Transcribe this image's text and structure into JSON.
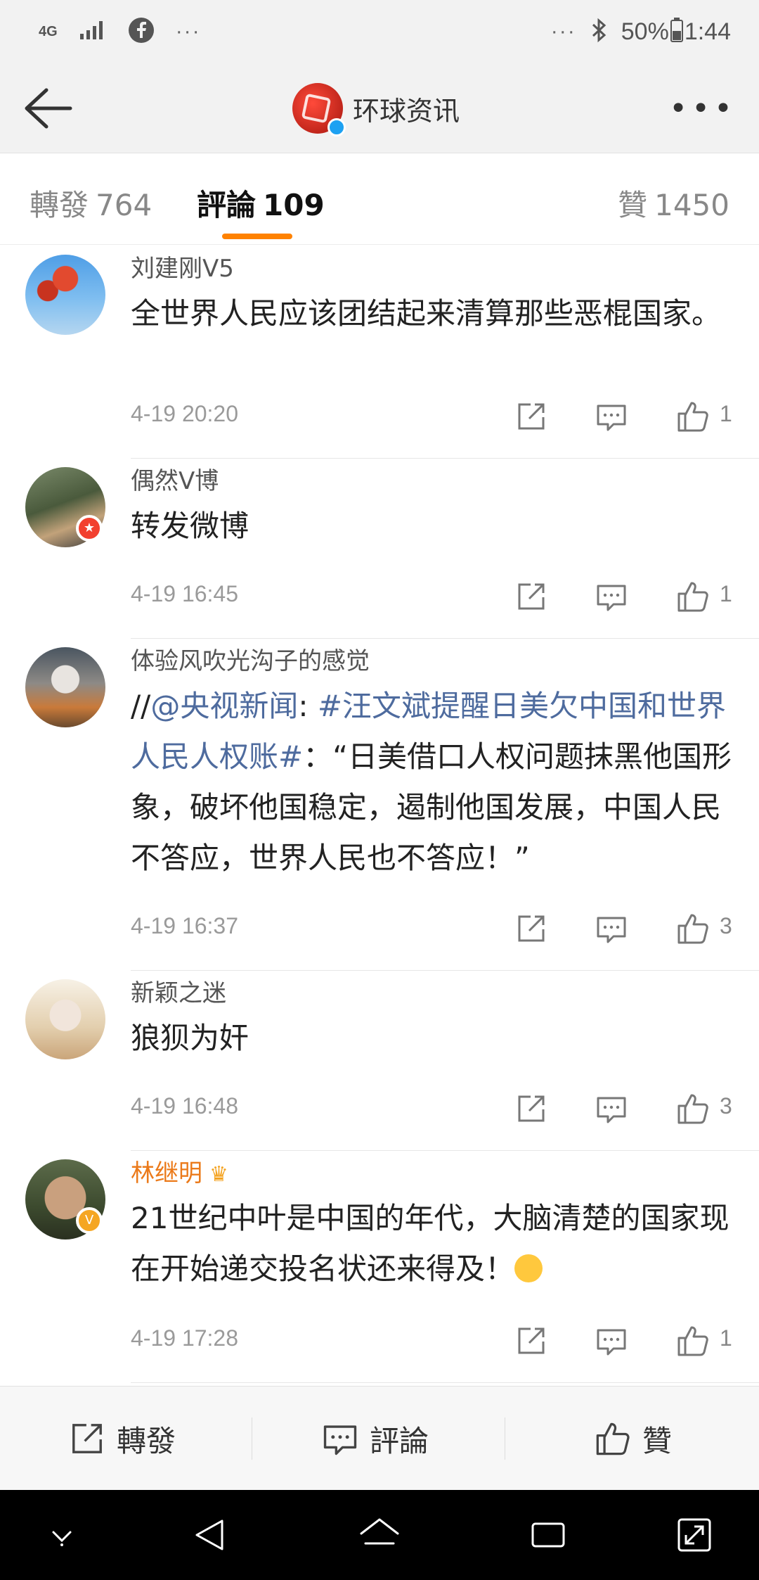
{
  "status_bar": {
    "network": "4G",
    "left_more": "···",
    "right_more": "···",
    "battery": "50%",
    "time": "1:44"
  },
  "header": {
    "title": "环球资讯",
    "more": "•••"
  },
  "tabs": [
    {
      "label": "轉發",
      "count": "764"
    },
    {
      "label": "評論",
      "count": "109"
    },
    {
      "label": "贊",
      "count": "1450"
    }
  ],
  "colors": {
    "accent": "#ff8200",
    "link": "#4e6b9e",
    "vip_name": "#eb7a1a",
    "badge_red": "#f2402f",
    "badge_gold": "#f5a623"
  },
  "comments": [
    {
      "user": "刘建刚V5",
      "text": "全世界人民应该团结起来清算那些恶棍国家。",
      "time": "4-19 20:20",
      "likes": "1"
    },
    {
      "user": "偶然V博",
      "text": "转发微博",
      "time": "4-19 16:45",
      "likes": "1"
    },
    {
      "user": "体验风吹光沟子的感觉",
      "text_prefix": "//",
      "mention": "@央视新闻",
      "colon": ": ",
      "hashtag": "#汪文斌提醒日美欠中国和世界人民人权账#",
      "text_rest": "：“日美借口人权问题抹黑他国形象，破坏他国稳定，遏制他国发展，中国人民不答应，世界人民也不答应！”",
      "time": "4-19 16:37",
      "likes": "3"
    },
    {
      "user": "新颖之迷",
      "text": "狼狈为奸",
      "time": "4-19 16:48",
      "likes": "3"
    },
    {
      "user": "林继明",
      "text": "21世纪中叶是中国的年代，大脑清楚的国家现在开始递交投名状还来得及！",
      "time": "4-19 17:28",
      "likes": "1"
    }
  ],
  "bottom_bar": {
    "repost": "轉發",
    "comment": "評論",
    "like": "贊"
  }
}
